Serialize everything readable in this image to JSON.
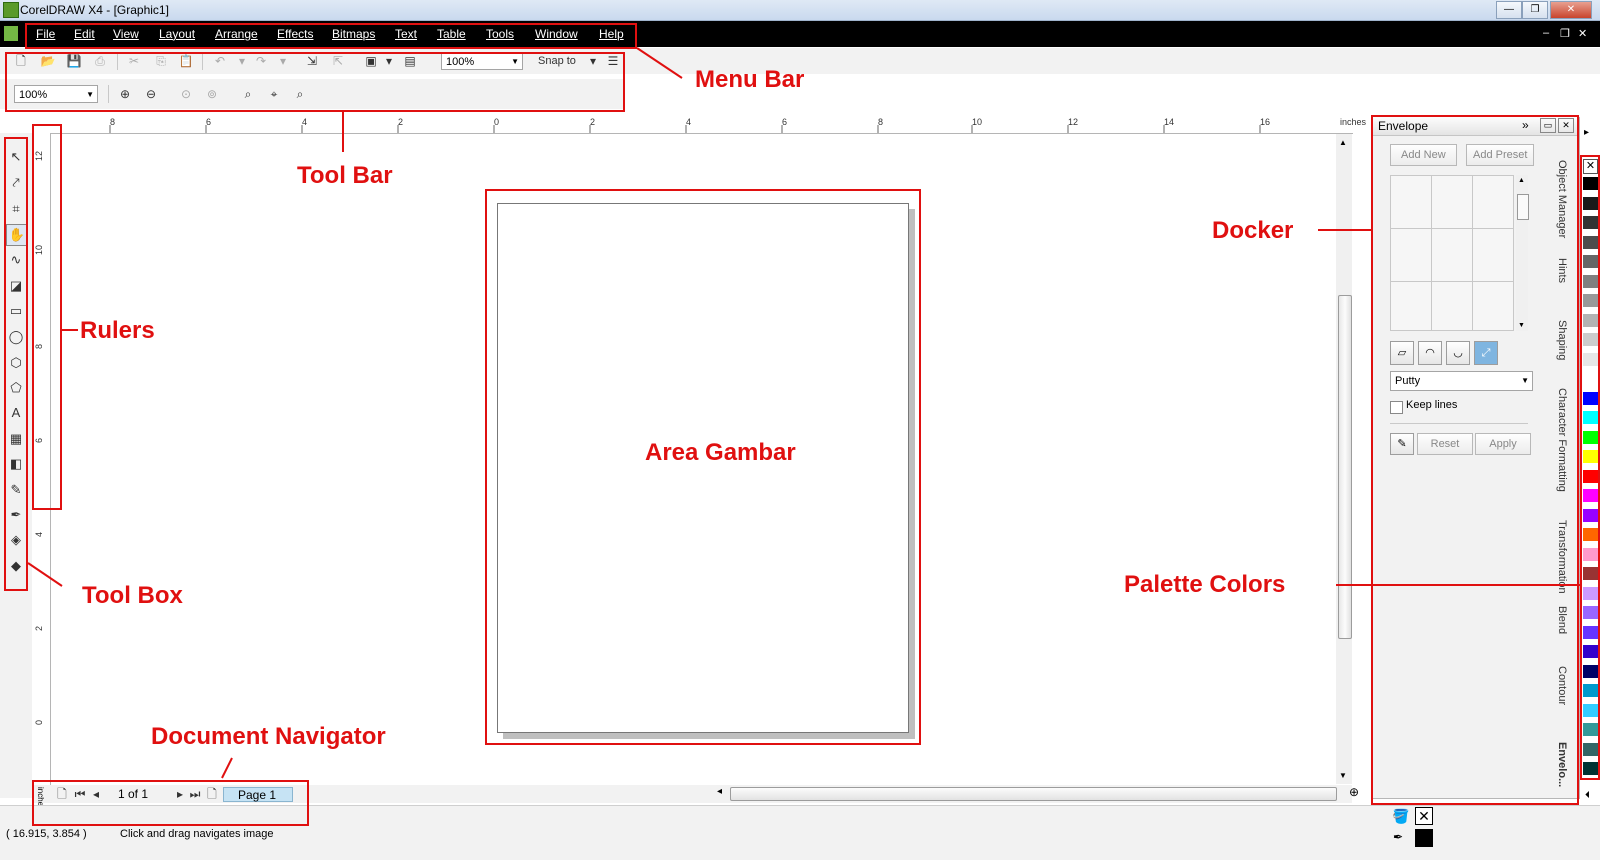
{
  "window": {
    "title": "CorelDRAW X4 - [Graphic1]",
    "min_icon": "minimize-icon",
    "max_icon": "maximize-icon",
    "close_icon": "close-icon"
  },
  "menu": {
    "items": [
      "File",
      "Edit",
      "View",
      "Layout",
      "Arrange",
      "Effects",
      "Bitmaps",
      "Text",
      "Table",
      "Tools",
      "Window",
      "Help"
    ],
    "mdi_controls": [
      "–",
      "❐",
      "✕"
    ]
  },
  "toolbar": {
    "zoom_level": "100%",
    "snap_label": "Snap to",
    "zoom_combo": "100%"
  },
  "ruler": {
    "unit": "inches",
    "h_ticks": [
      "8",
      "6",
      "4",
      "2",
      "0",
      "2",
      "4",
      "6",
      "8",
      "10",
      "12",
      "14",
      "16"
    ],
    "v_ticks": [
      "12",
      "10",
      "8",
      "6",
      "4",
      "2",
      "0"
    ]
  },
  "docker": {
    "title": "Envelope",
    "add_new": "Add New",
    "add_preset": "Add Preset",
    "mode": "Putty",
    "keep_lines": "Keep lines",
    "reset": "Reset",
    "apply": "Apply",
    "tabs": [
      "Object Manager",
      "Hints",
      "Shaping",
      "Character Formatting",
      "Transformation",
      "Blend",
      "Contour",
      "Envelo..."
    ]
  },
  "navigator": {
    "page_count": "1 of 1",
    "page_tab": "Page 1"
  },
  "status": {
    "coords": "( 16.915, 3.854 )",
    "hint": "Click and drag navigates image"
  },
  "annotations": {
    "menu_bar": "Menu Bar",
    "tool_bar": "Tool Bar",
    "rulers": "Rulers",
    "tool_box": "Tool Box",
    "area_gambar": "Area Gambar",
    "docker": "Docker",
    "palette_colors": "Palette Colors",
    "document_navigator": "Document Navigator"
  },
  "palette": {
    "colors": [
      "#000000",
      "#1a1a1a",
      "#333333",
      "#4d4d4d",
      "#666666",
      "#808080",
      "#999999",
      "#b3b3b3",
      "#cccccc",
      "#e6e6e6",
      "#ffffff",
      "#0000ff",
      "#00ffff",
      "#00ff00",
      "#ffff00",
      "#ff0000",
      "#ff00ff",
      "#9900ff",
      "#ff6600",
      "#ff99cc",
      "#993333",
      "#cc99ff",
      "#9966ff",
      "#6633ff",
      "#3300cc",
      "#000066",
      "#0099cc",
      "#33ccff",
      "#339999",
      "#336666",
      "#003333"
    ]
  },
  "accent_color": "#e01010"
}
